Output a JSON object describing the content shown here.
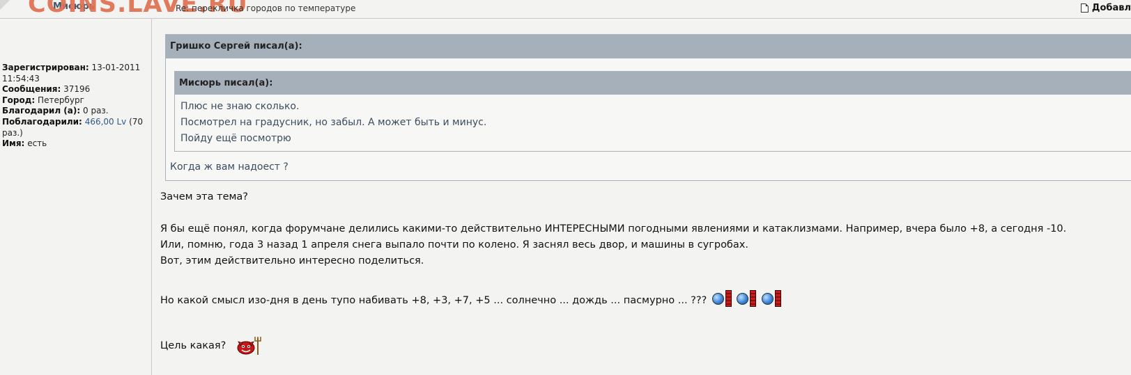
{
  "header": {
    "author": "Мисюрь",
    "watermark": "COINS.LAVE.RU",
    "subject": "Re: перекличка городов по температуре",
    "add_label": "Добавл"
  },
  "profile": {
    "registered_label": "Зарегистрирован:",
    "registered_value": "13-01-2011 11:54:43",
    "messages_label": "Сообщения:",
    "messages_value": "37196",
    "city_label": "Город:",
    "city_value": "Петербург",
    "thanked_label": "Благодарил (а):",
    "thanked_value": "0 раз.",
    "thanks_received_label": "Поблагодарили:",
    "thanks_received_link": "466,00 Lv",
    "thanks_received_rest": "(70 раз.)",
    "name_label": "Имя:",
    "name_value": "есть"
  },
  "quote_outer": {
    "head": "Гришко Сергей писал(а):",
    "reply": "Когда ж вам надоест ?"
  },
  "quote_inner": {
    "head": "Мисюрь писал(а):",
    "lines": [
      "Плюс не знаю сколько.",
      "Посмотрел на градусник, но забыл. А может быть и минус.",
      "Пойду ещё посмотрю"
    ]
  },
  "message": {
    "line1": "Зачем эта тема?",
    "line2": "Я бы ещё понял, когда форумчане делились какими-то действительно ИНТЕРЕСНЫМИ погодными явлениями и катаклизмами. Например, вчера было +8, а сегодня -10.",
    "line3": "Или, помню, года 3 назад 1 апреля снега выпало почти по колено. Я заснял весь двор, и машины в сугробах.",
    "line4": "Вот, этим действительно интересно поделиться.",
    "line5": "Но какой смысл изо-дня в день тупо набивать +8, +3, +7, +5 ... солнечно ... дождь ... пасмурно ... ???",
    "line6": "Цель какая?"
  },
  "icons": [
    "page-icon",
    "hit-wall-smiley-icon",
    "devil-smiley-icon"
  ],
  "colors": {
    "quote_header": "#a6b0bb",
    "quote_text": "#3b4c5e",
    "watermark": "#e07050",
    "link": "#2d5a88"
  }
}
